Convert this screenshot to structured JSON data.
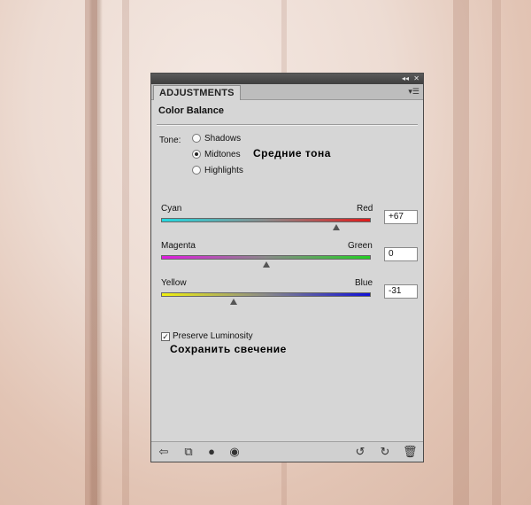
{
  "panel": {
    "tab_label": "ADJUSTMENTS",
    "title": "Color Balance",
    "tone": {
      "label": "Tone:",
      "options": [
        "Shadows",
        "Midtones",
        "Highlights"
      ],
      "selected": "Midtones",
      "annotation": "Средние тона"
    },
    "sliders": [
      {
        "left": "Cyan",
        "right": "Red",
        "value": "+67",
        "level": 67
      },
      {
        "left": "Magenta",
        "right": "Green",
        "value": "0",
        "level": 0
      },
      {
        "left": "Yellow",
        "right": "Blue",
        "value": "-31",
        "level": -31
      }
    ],
    "preserve": {
      "label": "Preserve Luminosity",
      "checked": true,
      "annotation": "Сохранить свечение"
    }
  },
  "colors": {
    "panel_bg": "#d6d6d6",
    "cyan": "#22d8e0",
    "red": "#e01a1a",
    "magenta": "#e01ae0",
    "green": "#22d022",
    "yellow": "#f0f010",
    "blue": "#1010d8"
  },
  "bottom_icons": [
    "back-arrow-icon",
    "clip-layer-icon",
    "mask-icon",
    "eye-icon",
    "view-previous-icon",
    "reset-icon",
    "trash-icon"
  ]
}
